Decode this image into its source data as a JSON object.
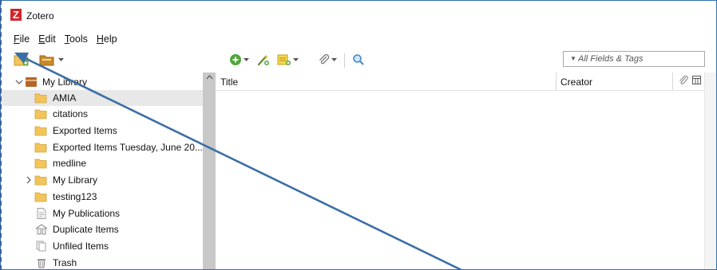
{
  "window": {
    "title": "Zotero",
    "app_icon_letter": "Z",
    "icon_color": "#d4252b"
  },
  "menu": [
    {
      "mnemonic": "F",
      "rest": "ile"
    },
    {
      "mnemonic": "E",
      "rest": "dit"
    },
    {
      "mnemonic": "T",
      "rest": "ools"
    },
    {
      "mnemonic": "H",
      "rest": "elp"
    }
  ],
  "toolbar": {
    "left_buttons": [
      "new-collection-icon",
      "new-library-icon"
    ],
    "item_buttons": [
      "new-item-icon",
      "add-by-identifier-icon",
      "new-note-icon",
      "add-attachment-icon",
      "advanced-search-icon"
    ],
    "search": {
      "placeholder": "All Fields & Tags",
      "value": ""
    }
  },
  "collections": [
    {
      "label": "My Library",
      "icon": "library-icon",
      "twisty": "expanded"
    },
    {
      "label": "AMIA",
      "icon": "folder-icon",
      "selected": true
    },
    {
      "label": "citations",
      "icon": "folder-icon"
    },
    {
      "label": "Exported Items",
      "icon": "folder-icon"
    },
    {
      "label": "Exported Items Tuesday, June 20...",
      "icon": "folder-icon"
    },
    {
      "label": "medline",
      "icon": "folder-icon"
    },
    {
      "label": "My Library",
      "icon": "folder-icon",
      "twisty": "collapsed"
    },
    {
      "label": "testing123",
      "icon": "folder-icon"
    },
    {
      "label": "My Publications",
      "icon": "publications-icon"
    },
    {
      "label": "Duplicate Items",
      "icon": "duplicate-icon"
    },
    {
      "label": "Unfiled Items",
      "icon": "unfiled-icon"
    },
    {
      "label": "Trash",
      "icon": "trash-icon"
    }
  ],
  "items_table": {
    "columns": [
      "Title",
      "Creator"
    ],
    "sort_indicator": "ascending",
    "rows": []
  },
  "annotation": {
    "color": "#3c6ea6",
    "description": "arrow pointing to File menu"
  },
  "colors": {
    "accent": "#2f6fb0",
    "folder": "#f2c45a",
    "selection": "#e8e8e8",
    "splitter": "#c8c8c8"
  }
}
